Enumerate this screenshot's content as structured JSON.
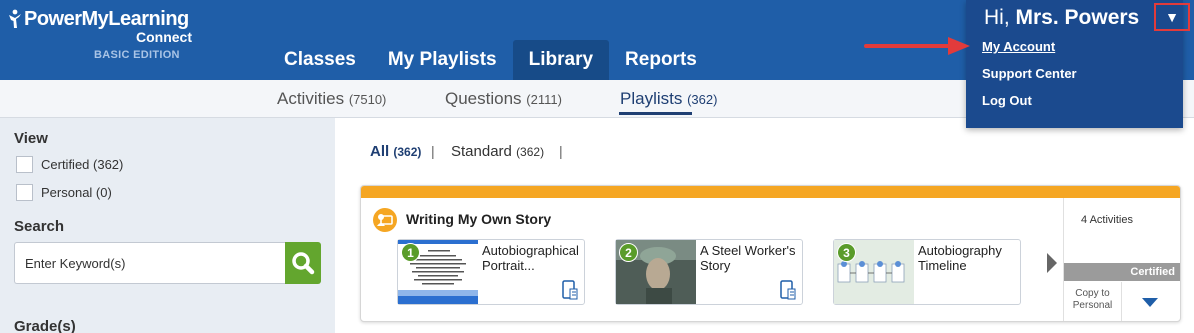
{
  "header": {
    "logo_line1": "PowerMyLearning",
    "logo_line2": "Connect",
    "logo_edition": "BASIC EDITION",
    "nav": [
      {
        "label": "Classes"
      },
      {
        "label": "My Playlists"
      },
      {
        "label": "Library",
        "active": true
      },
      {
        "label": "Reports"
      }
    ],
    "greeting_prefix": "Hi,",
    "user_name": "Mrs. Powers",
    "caret": "▼"
  },
  "user_menu": {
    "items": [
      "My Account",
      "Support Center",
      "Log Out"
    ]
  },
  "subnav": {
    "tabs": [
      {
        "label": "Activities",
        "count": "(7510)"
      },
      {
        "label": "Questions",
        "count": "(2111)"
      },
      {
        "label": "Playlists",
        "count": "(362)",
        "active": true
      }
    ]
  },
  "sidebar": {
    "view_heading": "View",
    "options": [
      {
        "label": "Certified (362)"
      },
      {
        "label": "Personal (0)"
      }
    ],
    "search_heading": "Search",
    "search_placeholder": "Enter Keyword(s)",
    "grades_heading": "Grade(s)"
  },
  "filters": {
    "all_label": "All",
    "all_count": "(362)",
    "standard_label": "Standard",
    "standard_count": "(362)",
    "separator": "|"
  },
  "playlist": {
    "title": "Writing My Own Story",
    "activity_count": "4 Activities",
    "badge": "Certified",
    "copy_label": "Copy to Personal",
    "activities": [
      {
        "num": "1",
        "label": "Autobiographical Portrait..."
      },
      {
        "num": "2",
        "label": "A Steel Worker's Story"
      },
      {
        "num": "3",
        "label": "Autobiography Timeline"
      }
    ]
  },
  "colors": {
    "header_blue": "#1f5ea8",
    "accent_orange": "#f5a623",
    "search_green": "#63a62e",
    "highlight_red": "#e23b3b"
  }
}
